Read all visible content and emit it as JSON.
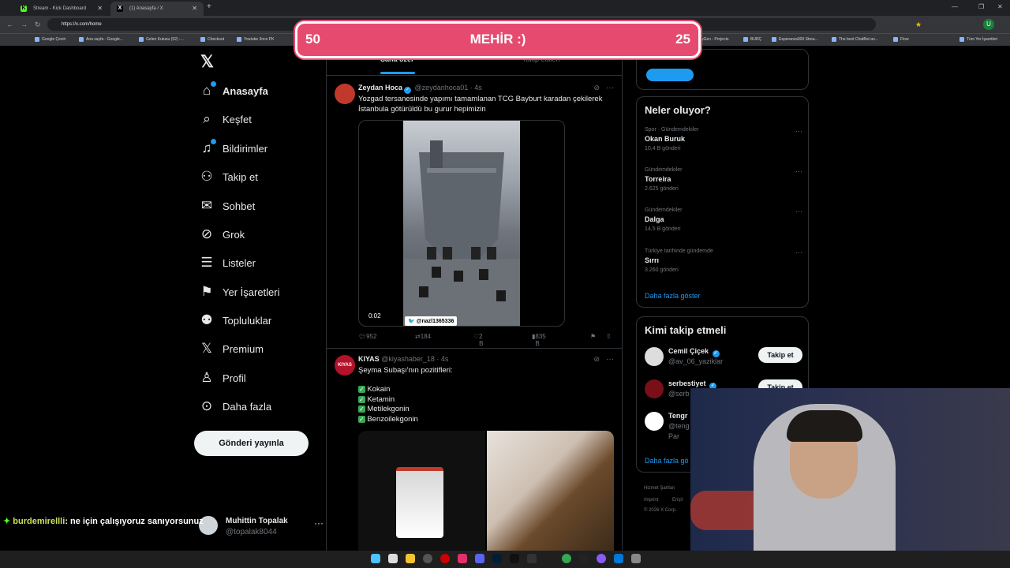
{
  "browser": {
    "tabs": [
      {
        "title": "Stream - Kick Dashboard",
        "active": false
      },
      {
        "title": "(1) Anasayfa / X",
        "active": true
      }
    ],
    "url": "https://x.com/home",
    "bookmarks": [
      "Google Çeviri",
      "Ana sayfa - Google...",
      "Gelen Kutusu (52) -...",
      "Checkout",
      "Youtube 3nco PK",
      "yGen - Projects",
      "BURÇ",
      "Esperanza000 Strea...",
      "The best ChatBot an...",
      "Flow",
      "Tüm Yer İşaretleri"
    ]
  },
  "overlay": {
    "left_score": "50",
    "label": "MEHİR :)",
    "right_score": "25"
  },
  "nav": {
    "items": [
      {
        "label": "Anasayfa",
        "icon": "home-icon"
      },
      {
        "label": "Keşfet",
        "icon": "search-icon"
      },
      {
        "label": "Bildirimler",
        "icon": "bell-icon"
      },
      {
        "label": "Takip et",
        "icon": "add-user-icon"
      },
      {
        "label": "Sohbet",
        "icon": "mail-icon"
      },
      {
        "label": "Grok",
        "icon": "grok-icon"
      },
      {
        "label": "Listeler",
        "icon": "list-icon"
      },
      {
        "label": "Yer İşaretleri",
        "icon": "bookmark-icon"
      },
      {
        "label": "Topluluklar",
        "icon": "communities-icon"
      },
      {
        "label": "Premium",
        "icon": "x-logo-icon"
      },
      {
        "label": "Profil",
        "icon": "person-icon"
      },
      {
        "label": "Daha fazla",
        "icon": "more-circle-icon"
      }
    ],
    "post_button": "Gönderi yayınla",
    "account": {
      "name": "Muhittin Topalak",
      "handle": "@topalak8044"
    }
  },
  "feed": {
    "tabs": [
      "Sana özel",
      "Takip edilen"
    ],
    "tweets": [
      {
        "name": "Zeydan Hoca",
        "handle": "@zeydanhoca01",
        "time": "4s",
        "text": "Yozgad tersanesinde yapımı tamamlanan TCG Bayburt karadan çekilerek İstanbula götürüldü bu gurur hepimizin",
        "video_time": "0:02",
        "watermark": "@nazl1365336",
        "replies": "952",
        "retweets": "184",
        "likes": "2 B",
        "views": "835 B"
      },
      {
        "name": "KIYAS",
        "avatar_text": "KIYAS",
        "handle": "@kiyashaber_18",
        "time": "4s",
        "text": "Şeyma Subaşı'nın pozitifleri:",
        "list": [
          "Kokain",
          "Ketamin",
          "Metilekgonin",
          "Benzoilekgonin"
        ]
      }
    ]
  },
  "sidebar": {
    "trends_title": "Neler oluyor?",
    "trends": [
      {
        "context": "Spor · Gündemdekiler",
        "name": "Okan Buruk",
        "posts": "10,4 B gönderi"
      },
      {
        "context": "Gündemdekiler",
        "name": "Torreira",
        "posts": "2.625 gönderi"
      },
      {
        "context": "Gündemdekiler",
        "name": "Dalga",
        "posts": "14,5 B gönderi"
      },
      {
        "context": "Türkiye tarihinde gündemde",
        "name": "Sırrı",
        "posts": "3.260 gönderi"
      }
    ],
    "show_more": "Daha fazla göster",
    "who_title": "Kimi takip etmeli",
    "who": [
      {
        "name": "Cemil Çiçek",
        "handle": "@av_06_yaziklar",
        "button": "Takip et"
      },
      {
        "name": "serbestiyet",
        "handle": "@serb",
        "button": "Takip et"
      },
      {
        "name": "Tengr",
        "handle": "@teng",
        "extra": "Par"
      }
    ],
    "who_more": "Daha fazla gö",
    "footer": [
      "Hizmet Şartları",
      "Imprint",
      "Erişil",
      "© 2026 X Corp."
    ]
  },
  "chat": {
    "user": "burdemirellli",
    "message": ": ne için çalışıyoruz sanıyorsunuz"
  }
}
